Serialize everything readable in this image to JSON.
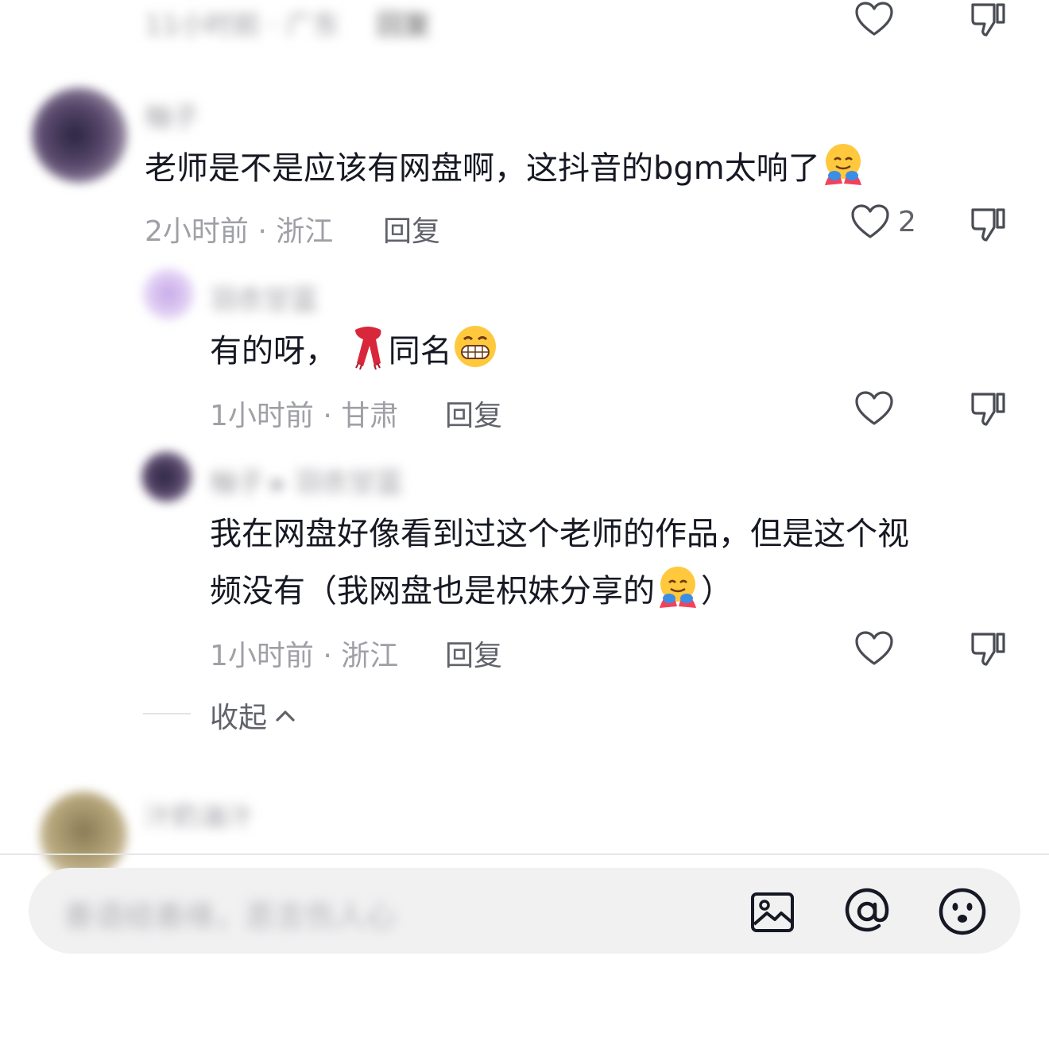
{
  "top_comment_meta": "11小时前 · 广东",
  "top_comment_reply": "回复",
  "comment1": {
    "author": "柚子",
    "text": "老师是不是应该有网盘啊，这抖音的bgm太响了",
    "meta": "2小时前 · 浙江",
    "reply": "回复",
    "likes": "2",
    "emoji": "hugging-face-emoji"
  },
  "reply1": {
    "author": "羽衣甘蓝",
    "text_before": "有的呀，",
    "text_after": "同名",
    "meta": "1小时前 · 甘肃",
    "reply": "回复",
    "emoji1": "scarf-emoji",
    "emoji2": "grinning-face-emoji"
  },
  "reply2": {
    "author": "柚子 ▸ 羽衣甘蓝",
    "line1": "我在网盘好像看到过这个老师的作品，但是这个视",
    "line2_before": "频没有（我网盘也是枳妹分享的",
    "line2_after": "）",
    "meta": "1小时前 · 浙江",
    "reply": "回复",
    "emoji": "hugging-face-emoji"
  },
  "collapse_label": "收起",
  "next_comment": {
    "author": "汁奶油汁"
  },
  "input": {
    "placeholder": "善语结善缘，恶言伤人心"
  },
  "icons": [
    "image-icon",
    "at-icon",
    "emoji-icon"
  ],
  "colors": {
    "text": "#161823",
    "meta": "#9fa0a6",
    "reply": "#61636b",
    "input_bg": "#f1f1f2"
  }
}
